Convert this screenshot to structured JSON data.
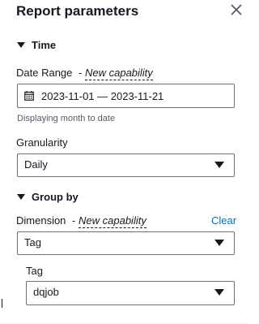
{
  "panel": {
    "title": "Report parameters"
  },
  "time_section": {
    "label": "Time",
    "date_range": {
      "label": "Date Range",
      "separator": "-",
      "badge": "New capability",
      "value": "2023-11-01 — 2023-11-21",
      "hint": "Displaying month to date"
    },
    "granularity": {
      "label": "Granularity",
      "value": "Daily"
    }
  },
  "group_by_section": {
    "label": "Group by",
    "dimension": {
      "label": "Dimension",
      "separator": "-",
      "badge": "New capability",
      "clear_label": "Clear",
      "value": "Tag"
    },
    "tag": {
      "label": "Tag",
      "value": "dqjob"
    }
  },
  "icons": {
    "close": "close-icon",
    "calendar": "calendar-icon",
    "expand": "caret-down-icon",
    "dropdown": "dropdown-triangle-icon"
  },
  "colors": {
    "text": "#16191f",
    "link": "#0073bb",
    "border": "#687078",
    "hint": "#545b64"
  }
}
